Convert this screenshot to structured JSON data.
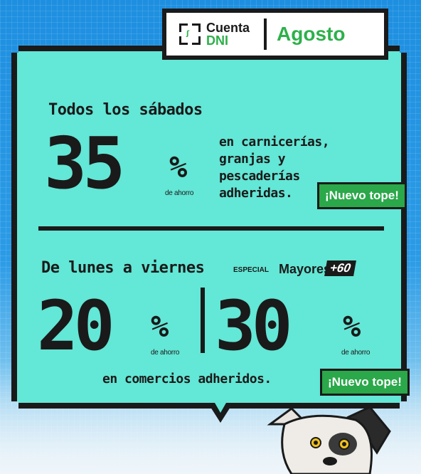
{
  "brand": {
    "app_name": "Cuenta",
    "app_name_2": "DNI",
    "month": "Agosto"
  },
  "section1": {
    "heading": "Todos los sábados",
    "value": "35",
    "percent_sign": "%",
    "savings_label": "de ahorro",
    "description_lines": [
      "en carnicerías,",
      "granjas y",
      "pescaderías",
      "adheridas."
    ],
    "badge": "¡Nuevo tope!"
  },
  "section2": {
    "heading": "De lunes a viernes",
    "special_label": "ESPECIAL",
    "seniors_label": "Mayores",
    "seniors_badge": "+60",
    "value_regular": "20",
    "value_seniors": "30",
    "percent_sign": "%",
    "savings_label": "de ahorro",
    "description": "en comercios adheridos.",
    "badge": "¡Nuevo tope!"
  },
  "colors": {
    "panel": "#63e7d6",
    "accent_green": "#2aa84a",
    "background_blue": "#1e8fe0",
    "ink": "#1a1a1a"
  }
}
